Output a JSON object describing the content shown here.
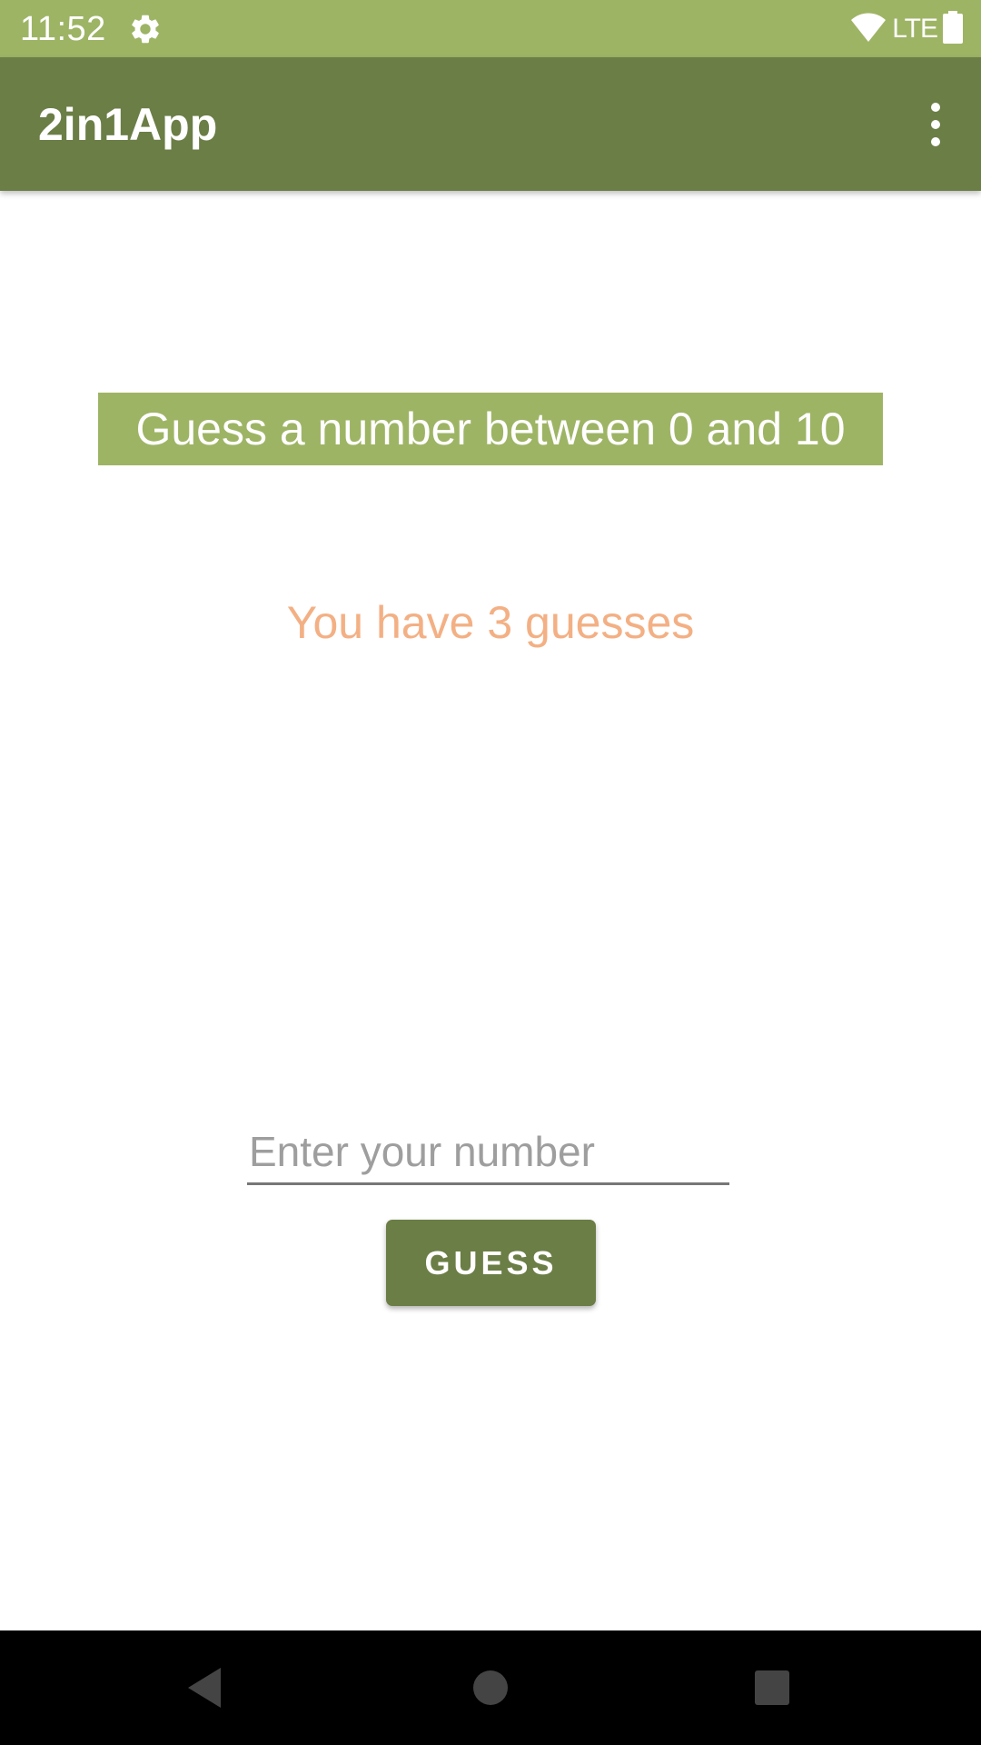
{
  "status_bar": {
    "time": "11:52",
    "network": "LTE",
    "icons": [
      "gear-icon",
      "wifi-icon",
      "battery-icon"
    ],
    "background": "#9eb465"
  },
  "app_bar": {
    "title": "2in1App",
    "menu_icon": "more-vert-icon",
    "background": "#6b7e46"
  },
  "game": {
    "instruction": "Guess a number between 0 and 10",
    "instruction_background": "#9eb465",
    "guesses_remaining_text": "You have 3 guesses",
    "guesses_text_color": "#f3b084",
    "input_placeholder": "Enter your number",
    "input_value": "",
    "guess_button_label": "GUESS"
  },
  "nav_bar": {
    "icons": [
      "back-icon",
      "home-icon",
      "recents-icon"
    ]
  }
}
